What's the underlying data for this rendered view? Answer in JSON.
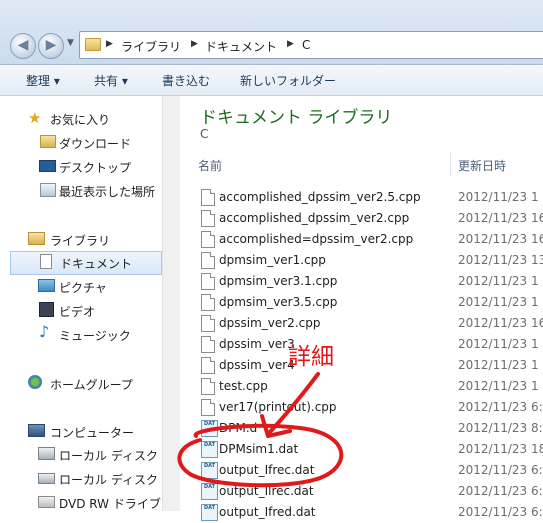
{
  "breadcrumb": {
    "items": [
      "ライブラリ",
      "ドキュメント",
      "C"
    ]
  },
  "toolbar": {
    "organize": "整理 ▾",
    "share": "共有 ▾",
    "burn": "書き込む",
    "new_folder": "新しいフォルダー"
  },
  "sidebar": {
    "favorites": {
      "label": "お気に入り",
      "items": [
        "ダウンロード",
        "デスクトップ",
        "最近表示した場所"
      ]
    },
    "libraries": {
      "label": "ライブラリ",
      "items": [
        "ドキュメント",
        "ピクチャ",
        "ビデオ",
        "ミュージック"
      ]
    },
    "homegroup": "ホームグループ",
    "computer": {
      "label": "コンピューター",
      "items": [
        "ローカル ディスク",
        "ローカル ディスク",
        "DVD RW ドライブ"
      ]
    }
  },
  "library": {
    "title": "ドキュメント ライブラリ",
    "subtitle": "C"
  },
  "columns": {
    "name": "名前",
    "date": "更新日時"
  },
  "files": [
    {
      "name": "accomplished_dpssim_ver2.5.cpp",
      "date": "2012/11/23 1",
      "type": "doc"
    },
    {
      "name": "accomplished_dpssim_ver2.cpp",
      "date": "2012/11/23 16",
      "type": "doc"
    },
    {
      "name": "accomplished=dpssim_ver2.cpp",
      "date": "2012/11/23 16",
      "type": "doc"
    },
    {
      "name": "dpmsim_ver1.cpp",
      "date": "2012/11/23 13",
      "type": "doc"
    },
    {
      "name": "dpmsim_ver3.1.cpp",
      "date": "2012/11/23 1",
      "type": "doc"
    },
    {
      "name": "dpmsim_ver3.5.cpp",
      "date": "2012/11/23 1",
      "type": "doc"
    },
    {
      "name": "dpssim_ver2.cpp",
      "date": "2012/11/23 16",
      "type": "doc"
    },
    {
      "name": "dpssim_ver3",
      "date": "2012/11/23 1",
      "type": "doc"
    },
    {
      "name": "dpssim_ver4",
      "date": "2012/11/23 1",
      "type": "doc"
    },
    {
      "name": "test.cpp",
      "date": "2012/11/23 1",
      "type": "doc"
    },
    {
      "name": "ver17(printout).cpp",
      "date": "2012/11/23 6:4",
      "type": "doc"
    },
    {
      "name": "DPM.d",
      "date": "2012/11/23 8:3",
      "type": "dat"
    },
    {
      "name": "DPMsim1.dat",
      "date": "2012/11/23 18",
      "type": "dat"
    },
    {
      "name": "output_Ifrec.dat",
      "date": "2012/11/23 6:4",
      "type": "dat"
    },
    {
      "name": "output_Ilrec.dat",
      "date": "2012/11/23 6:4",
      "type": "dat"
    },
    {
      "name": "output_Ifred.dat",
      "date": "2012/11/23 6:4",
      "type": "dat"
    }
  ],
  "annotation": {
    "text": "詳細",
    "color": "#e0191b"
  }
}
